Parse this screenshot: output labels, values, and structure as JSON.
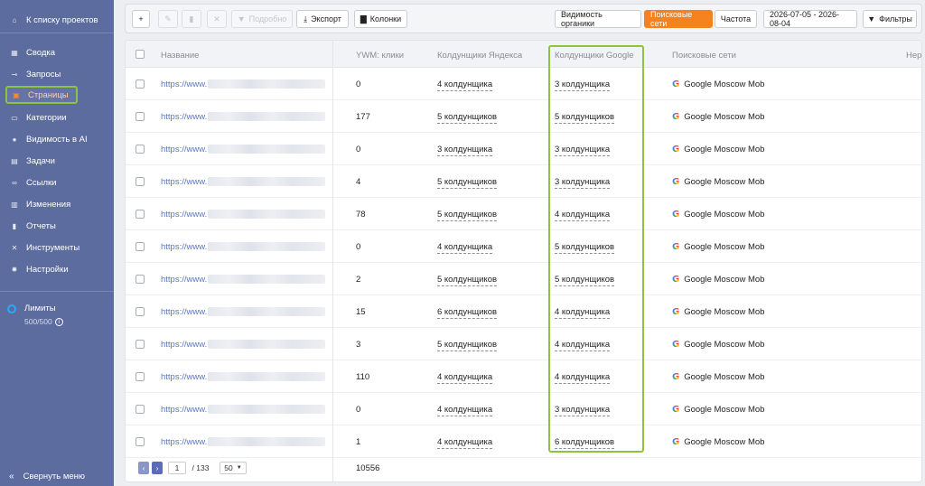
{
  "sidebar": {
    "back": "К списку проектов",
    "items": [
      {
        "label": "Сводка",
        "icon": "grid-icon"
      },
      {
        "label": "Запросы",
        "icon": "key-icon"
      },
      {
        "label": "Страницы",
        "icon": "page-icon"
      },
      {
        "label": "Категории",
        "icon": "folder-icon"
      },
      {
        "label": "Видимость в AI",
        "icon": "pin-icon"
      },
      {
        "label": "Задачи",
        "icon": "task-icon"
      },
      {
        "label": "Ссылки",
        "icon": "link-icon"
      },
      {
        "label": "Изменения",
        "icon": "changes-icon"
      },
      {
        "label": "Отчеты",
        "icon": "report-icon"
      },
      {
        "label": "Инструменты",
        "icon": "tools-icon"
      },
      {
        "label": "Настройки",
        "icon": "gear-icon"
      }
    ],
    "limits_label": "Лимиты",
    "limits_value": "500/500",
    "collapse": "Свернуть меню"
  },
  "toolbar": {
    "add": "+",
    "details": "Подробно",
    "export": "Экспорт",
    "columns": "Колонки",
    "organic": "Видимость органики",
    "search_networks": "Поисковые сети",
    "frequency": "Частота",
    "date_range": "2026-07-05 - 2026-08-04",
    "filters": "Фильтры"
  },
  "table": {
    "headers": {
      "name": "Название",
      "ywm": "YWM: клики",
      "yandex": "Колдунщики Яндекса",
      "google": "Колдунщики Google",
      "networks": "Поисковые сети",
      "extra": "Нере"
    },
    "rows": [
      {
        "url": "https://www.",
        "ywm": "0",
        "yandex": "4 колдунщика",
        "google": "3 колдунщика",
        "network": "Google Moscow Mob"
      },
      {
        "url": "https://www.",
        "ywm": "177",
        "yandex": "5 колдунщиков",
        "google": "5 колдунщиков",
        "network": "Google Moscow Mob"
      },
      {
        "url": "https://www.",
        "ywm": "0",
        "yandex": "3 колдунщика",
        "google": "3 колдунщика",
        "network": "Google Moscow Mob"
      },
      {
        "url": "https://www.",
        "ywm": "4",
        "yandex": "5 колдунщиков",
        "google": "3 колдунщика",
        "network": "Google Moscow Mob"
      },
      {
        "url": "https://www.",
        "ywm": "78",
        "yandex": "5 колдунщиков",
        "google": "4 колдунщика",
        "network": "Google Moscow Mob"
      },
      {
        "url": "https://www.",
        "ywm": "0",
        "yandex": "4 колдунщика",
        "google": "5 колдунщиков",
        "network": "Google Moscow Mob"
      },
      {
        "url": "https://www.",
        "ywm": "2",
        "yandex": "5 колдунщиков",
        "google": "5 колдунщиков",
        "network": "Google Moscow Mob"
      },
      {
        "url": "https://www.",
        "ywm": "15",
        "yandex": "6 колдунщиков",
        "google": "4 колдунщика",
        "network": "Google Moscow Mob"
      },
      {
        "url": "https://www.",
        "ywm": "3",
        "yandex": "5 колдунщиков",
        "google": "4 колдунщика",
        "network": "Google Moscow Mob"
      },
      {
        "url": "https://www.",
        "ywm": "110",
        "yandex": "4 колдунщика",
        "google": "4 колдунщика",
        "network": "Google Moscow Mob"
      },
      {
        "url": "https://www.",
        "ywm": "0",
        "yandex": "4 колдунщика",
        "google": "3 колдунщика",
        "network": "Google Moscow Mob"
      },
      {
        "url": "https://www.",
        "ywm": "1",
        "yandex": "4 колдунщика",
        "google": "6 колдунщиков",
        "network": "Google Moscow Mob"
      }
    ],
    "total_ywm": "10556"
  },
  "pagination": {
    "current": "1",
    "total": "/ 133",
    "per_page": "50"
  },
  "colors": {
    "sidebar": "#5c6c9f",
    "accent": "#f5821f",
    "highlight": "#8cc43f"
  }
}
